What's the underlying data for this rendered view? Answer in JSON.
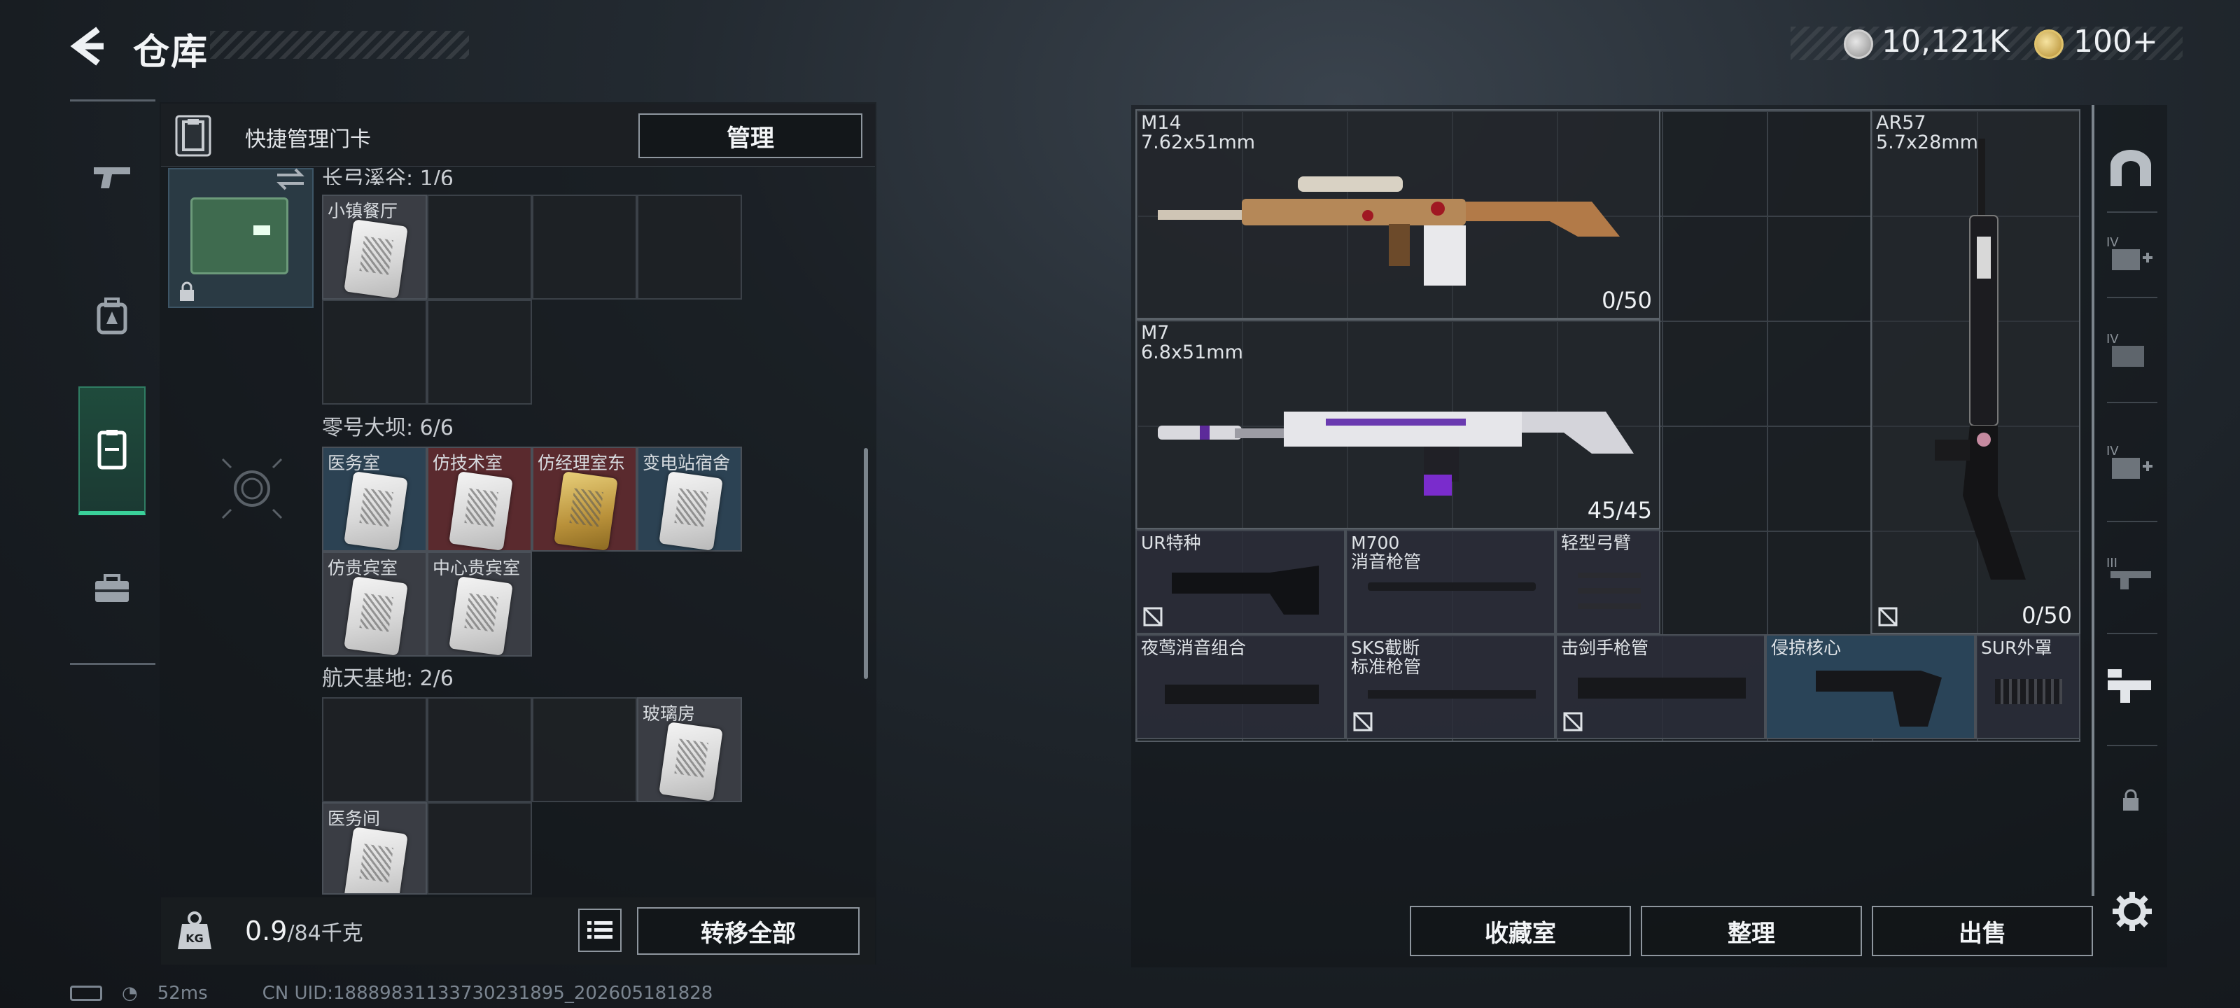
{
  "header": {
    "title": "仓库",
    "currency_1": "10,121K",
    "currency_2": "100+"
  },
  "left_panel": {
    "quick_manage_label": "快捷管理门卡",
    "manage_button": "管理",
    "partial_header": "长弓溪谷: 1/6",
    "sections": [
      {
        "label": "零号大坝: 6/6",
        "items": [
          "医务室",
          "仿技术室",
          "仿经理室东",
          "变电站宿舍",
          "仿贵宾室",
          "中心贵宾室"
        ]
      },
      {
        "label": "航天基地: 2/6",
        "items": [
          "玻璃房",
          "医务间"
        ]
      }
    ],
    "top_item": "小镇餐厅",
    "weight_value": "0.9",
    "weight_total": "/84千克",
    "transfer_all_button": "转移全部"
  },
  "right_panel": {
    "weapons": [
      {
        "name": "M14",
        "caliber": "7.62x51mm",
        "ammo": "0/50"
      },
      {
        "name": "M7",
        "caliber": "6.8x51mm",
        "ammo": "45/45"
      },
      {
        "name": "AR57",
        "caliber": "5.7x28mm",
        "ammo": "0/50"
      }
    ],
    "attachments_row1": [
      {
        "line1": "UR特种",
        "line2": ""
      },
      {
        "line1": "M700",
        "line2": "消音枪管"
      },
      {
        "line1": "轻型弓臂",
        "line2": ""
      }
    ],
    "attachments_row2": [
      {
        "line1": "夜莺消音组合",
        "line2": ""
      },
      {
        "line1": "SKS截断",
        "line2": "标准枪管"
      },
      {
        "line1": "击剑手枪管",
        "line2": ""
      },
      {
        "line1": "侵掠核心",
        "line2": ""
      },
      {
        "line1": "SUR外罩",
        "line2": ""
      }
    ],
    "buttons": {
      "collection": "收藏室",
      "organize": "整理",
      "sell": "出售"
    }
  },
  "status_bar": {
    "ping": "52ms",
    "uid": "CN UID:1888983113373023​1895_202605181828"
  },
  "colors": {
    "accent_green": "#3ad19a",
    "panel_bg": "#14181c",
    "blue_cell": "#2c4253",
    "red_cell": "#5a2a2e"
  },
  "icons": [
    "back-arrow-icon",
    "silver-coin-icon",
    "gold-coin-icon",
    "pistol-icon",
    "backpack-icon",
    "keycard-icon",
    "briefcase-icon",
    "safe-icon",
    "add-slot-icon",
    "gear-icon",
    "lock-icon",
    "list-icon",
    "weight-icon",
    "swap-icon"
  ]
}
